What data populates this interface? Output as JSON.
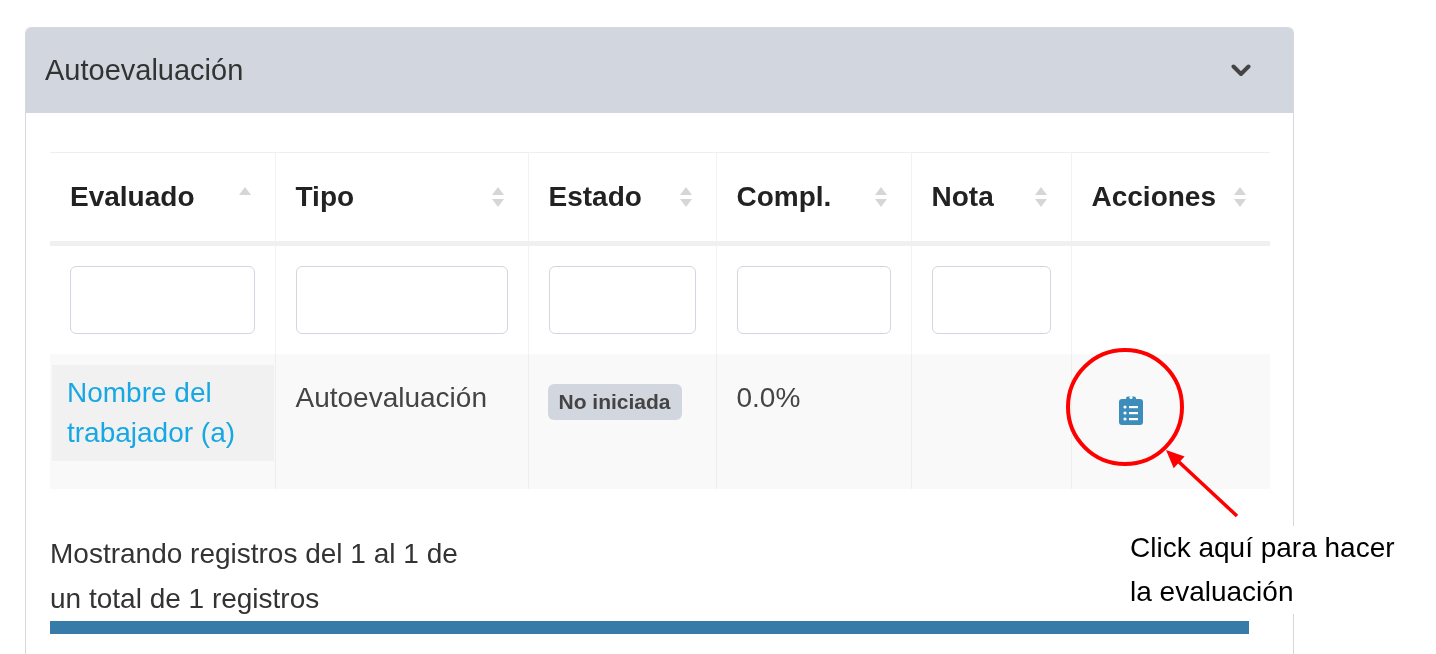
{
  "panel": {
    "title": "Autoevaluación"
  },
  "table": {
    "columns": [
      {
        "label": "Evaluado",
        "sorted": true,
        "filter": true
      },
      {
        "label": "Tipo",
        "sorted": false,
        "filter": true
      },
      {
        "label": "Estado",
        "sorted": false,
        "filter": true
      },
      {
        "label": "Compl.",
        "sorted": false,
        "filter": true
      },
      {
        "label": "Nota",
        "sorted": false,
        "filter": true
      },
      {
        "label": "Acciones",
        "sorted": false,
        "filter": false
      }
    ],
    "rows": [
      {
        "cells": [
          {
            "kind": "link",
            "text": "Nombre del trabajador (a)"
          },
          {
            "kind": "text",
            "text": "Autoevaluación"
          },
          {
            "kind": "badge",
            "text": "No iniciada"
          },
          {
            "kind": "text",
            "text": "0.0%"
          },
          {
            "kind": "empty"
          },
          {
            "kind": "action"
          }
        ]
      }
    ]
  },
  "footer": {
    "info": "Mostrando registros del 1 al 1 de un total de 1 registros"
  },
  "annotation": {
    "text": "Click aquí para hacer la evaluación"
  }
}
